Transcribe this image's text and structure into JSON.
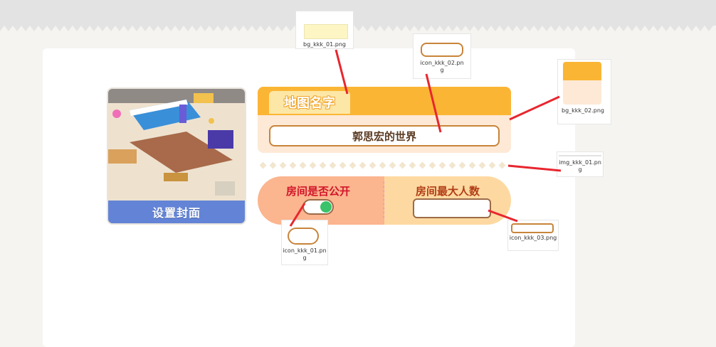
{
  "cover": {
    "button_label": "设置封面"
  },
  "map_card": {
    "title": "地图名字",
    "name_value": "郭思宏的世界"
  },
  "room_settings": {
    "public_label": "房间是否公开",
    "public_toggle_on": true,
    "max_players_label": "房间最大人数",
    "max_players_value": ""
  },
  "annotations": {
    "bg_kkk_01": "bg_kkk_01.png",
    "icon_kkk_02": "icon_kkk_02.png",
    "bg_kkk_02": "bg_kkk_02.png",
    "img_kkk_01": "img_kkk_01.png",
    "icon_kkk_01": "icon_kkk_01.png",
    "icon_kkk_03": "icon_kkk_03.png"
  },
  "colors": {
    "orange_header": "#fbb535",
    "card_body": "#fde9d6",
    "pill_left": "#fbb58f",
    "pill_right": "#fdd9a1",
    "toggle_on": "#3bc26a",
    "callout_line": "#e8262e"
  }
}
